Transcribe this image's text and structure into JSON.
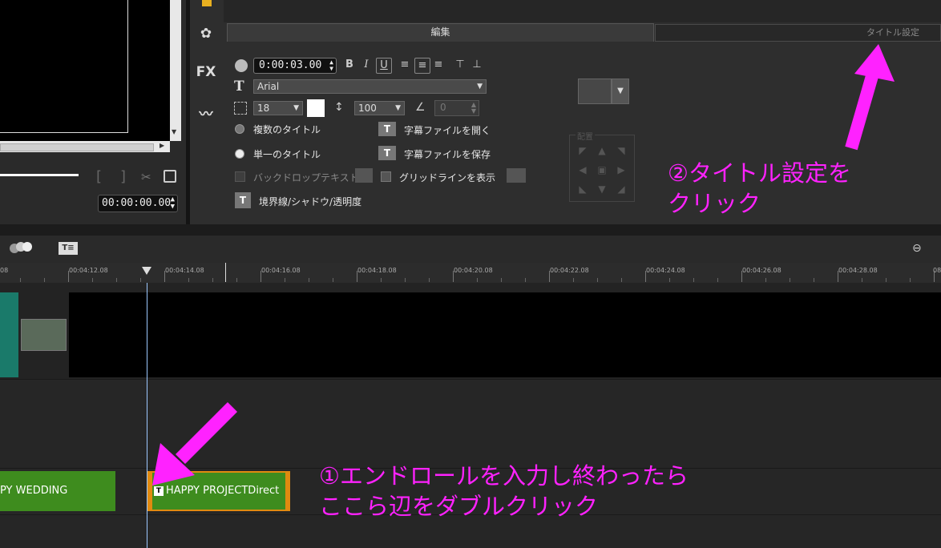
{
  "preview": {
    "timecode": "00:00:00.00"
  },
  "left_strip": {
    "fx_label": "FX"
  },
  "tabs": {
    "edit": "編集",
    "title_settings": "タイトル設定"
  },
  "options": {
    "duration": "0:00:03.00",
    "font": "Arial",
    "font_size": "18",
    "line_spacing": "100",
    "angle": "0",
    "multi_title": "複数のタイトル",
    "single_title": "単一のタイトル",
    "open_subtitle": "字幕ファイルを開く",
    "save_subtitle": "字幕ファイルを保存",
    "backdrop_text": "バックドロップテキスト",
    "show_gridlines": "グリッドラインを表示",
    "border_shadow": "境界線/シャドウ/透明度",
    "placement_label": "配置",
    "format": {
      "bold": "B",
      "italic": "I",
      "underline": "U"
    },
    "selected_radio": "single_title"
  },
  "ruler": {
    "labels": [
      "08",
      "00:04:12.08",
      "00:04:14.08",
      "00:04:16.08",
      "00:04:18.08",
      "00:04:20.08",
      "00:04:22.08",
      "00:04:24.08",
      "00:04:26.08",
      "00:04:28.08",
      "08"
    ]
  },
  "timeline": {
    "clip_wedding": "PY WEDDING",
    "clip_project": "HAPPY PROJECTDirect",
    "title_badge": "T"
  },
  "annotations": {
    "step2_line1": "②タイトル設定を",
    "step2_line2": "クリック",
    "step1_line1": "①エンドロールを入力し終わったら",
    "step1_line2": "ここら辺をダブルクリック",
    "color": "#ff22ff"
  }
}
